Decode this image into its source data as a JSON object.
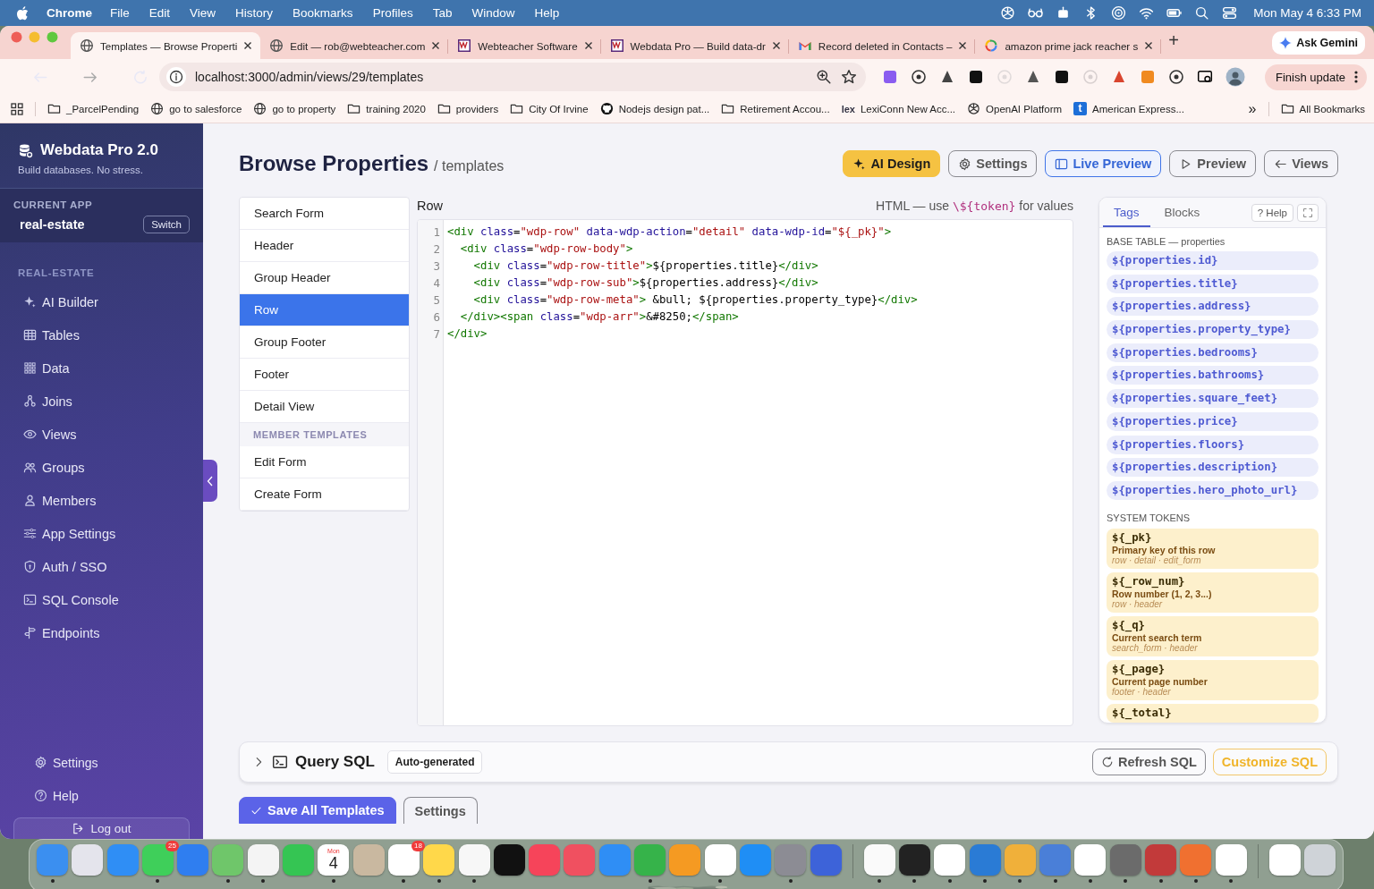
{
  "menubar": {
    "app": "Chrome",
    "menus": [
      "File",
      "Edit",
      "View",
      "History",
      "Bookmarks",
      "Profiles",
      "Tab",
      "Window",
      "Help"
    ],
    "clock": "Mon May 4  6:33 PM"
  },
  "browser_tabs": [
    {
      "title": "Templates — Browse Properti",
      "kind": "globe",
      "selected": true
    },
    {
      "title": "Edit — rob@webteacher.com",
      "kind": "globe",
      "selected": false
    },
    {
      "title": "Webteacher Software",
      "kind": "wt",
      "selected": false
    },
    {
      "title": "Webdata Pro — Build data-dr",
      "kind": "wt",
      "selected": false
    },
    {
      "title": "Record deleted in Contacts –",
      "kind": "gmail",
      "selected": false
    },
    {
      "title": "amazon prime jack reacher s",
      "kind": "google",
      "selected": false
    }
  ],
  "new_tab": "+",
  "ask_gemini": "Ask Gemini",
  "address": "localhost:3000/admin/views/29/templates",
  "finish_update": "Finish update",
  "bookmarks": [
    {
      "label": "_ParcelPending",
      "kind": "folder"
    },
    {
      "label": "go to salesforce",
      "kind": "globe"
    },
    {
      "label": "go to property",
      "kind": "globe"
    },
    {
      "label": "training 2020",
      "kind": "folder"
    },
    {
      "label": "providers",
      "kind": "folder"
    },
    {
      "label": "City Of Irvine",
      "kind": "folder"
    },
    {
      "label": "Nodejs design pat...",
      "kind": "github"
    },
    {
      "label": "Retirement Accou...",
      "kind": "folder"
    },
    {
      "label": "LexiConn New Acc...",
      "kind": "lex",
      "icon_text": "lex"
    },
    {
      "label": "OpenAI Platform",
      "kind": "knot"
    },
    {
      "label": "American Express...",
      "kind": "square",
      "icon_text": "t"
    }
  ],
  "more_bookmarks": "»",
  "all_bookmarks": "All Bookmarks",
  "sidebar": {
    "brand": "Webdata Pro 2.0",
    "tagline": "Build databases. No stress.",
    "current_app_label": "CURRENT APP",
    "current_app": "real-estate",
    "switch": "Switch",
    "section": "REAL-ESTATE",
    "nav": [
      {
        "label": "AI Builder",
        "kind": "sparkle"
      },
      {
        "label": "Tables",
        "kind": "table"
      },
      {
        "label": "Data",
        "kind": "grid"
      },
      {
        "label": "Joins",
        "kind": "nodes"
      },
      {
        "label": "Views",
        "kind": "eye"
      },
      {
        "label": "Groups",
        "kind": "people"
      },
      {
        "label": "Members",
        "kind": "person"
      },
      {
        "label": "App Settings",
        "kind": "sliders"
      },
      {
        "label": "Auth / SSO",
        "kind": "shield"
      },
      {
        "label": "SQL Console",
        "kind": "terminal"
      },
      {
        "label": "Endpoints",
        "kind": "signpost"
      }
    ],
    "footer": [
      {
        "label": "Settings",
        "kind": "gear"
      },
      {
        "label": "Help",
        "kind": "help"
      }
    ],
    "logout": "Log out"
  },
  "page": {
    "title": "Browse Properties",
    "subtitle": "/ templates",
    "actions": [
      {
        "label": "AI Design",
        "kind": "accent"
      },
      {
        "label": "Settings",
        "kind": "outline"
      },
      {
        "label": "Live Preview",
        "kind": "active"
      },
      {
        "label": "Preview",
        "kind": "outline"
      },
      {
        "label": "Views",
        "kind": "outline"
      }
    ]
  },
  "templates": [
    {
      "kind": "item",
      "label": "Search Form",
      "selected": false
    },
    {
      "kind": "item",
      "label": "Header",
      "selected": false
    },
    {
      "kind": "item",
      "label": "Group Header",
      "selected": false
    },
    {
      "kind": "item",
      "label": "Row",
      "selected": true
    },
    {
      "kind": "item",
      "label": "Group Footer",
      "selected": false
    },
    {
      "kind": "item",
      "label": "Footer",
      "selected": false
    },
    {
      "kind": "item",
      "label": "Detail View",
      "selected": false
    },
    {
      "kind": "header",
      "label": "MEMBER TEMPLATES"
    },
    {
      "kind": "item",
      "label": "Edit Form",
      "selected": false
    },
    {
      "kind": "item",
      "label": "Create Form",
      "selected": false
    }
  ],
  "editor": {
    "label": "Row",
    "hint_before": "HTML — use ",
    "hint_token": "\\${token}",
    "hint_after": " for values",
    "lines": [
      {
        "number": "1",
        "segments": [
          {
            "kind": "tag",
            "text": "<div"
          },
          {
            "kind": "attr",
            "text": " class"
          },
          {
            "kind": "plain",
            "text": "="
          },
          {
            "kind": "str",
            "text": "\"wdp-row\""
          },
          {
            "kind": "attr",
            "text": " data-wdp-action"
          },
          {
            "kind": "plain",
            "text": "="
          },
          {
            "kind": "str",
            "text": "\"detail\""
          },
          {
            "kind": "attr",
            "text": " data-wdp-id"
          },
          {
            "kind": "plain",
            "text": "="
          },
          {
            "kind": "str",
            "text": "\"${_pk}\""
          },
          {
            "kind": "tag",
            "text": ">"
          }
        ]
      },
      {
        "number": "2",
        "segments": [
          {
            "kind": "tag",
            "text": "  <div"
          },
          {
            "kind": "attr",
            "text": " class"
          },
          {
            "kind": "plain",
            "text": "="
          },
          {
            "kind": "str",
            "text": "\"wdp-row-body\""
          },
          {
            "kind": "tag",
            "text": ">"
          }
        ]
      },
      {
        "number": "3",
        "segments": [
          {
            "kind": "tag",
            "text": "    <div"
          },
          {
            "kind": "attr",
            "text": " class"
          },
          {
            "kind": "plain",
            "text": "="
          },
          {
            "kind": "str",
            "text": "\"wdp-row-title\""
          },
          {
            "kind": "tag",
            "text": ">"
          },
          {
            "kind": "plain",
            "text": "${properties.title}"
          },
          {
            "kind": "tag",
            "text": "</div>"
          }
        ]
      },
      {
        "number": "4",
        "segments": [
          {
            "kind": "tag",
            "text": "    <div"
          },
          {
            "kind": "attr",
            "text": " class"
          },
          {
            "kind": "plain",
            "text": "="
          },
          {
            "kind": "str",
            "text": "\"wdp-row-sub\""
          },
          {
            "kind": "tag",
            "text": ">"
          },
          {
            "kind": "plain",
            "text": "${properties.address}"
          },
          {
            "kind": "tag",
            "text": "</div>"
          }
        ]
      },
      {
        "number": "5",
        "segments": [
          {
            "kind": "tag",
            "text": "    <div"
          },
          {
            "kind": "attr",
            "text": " class"
          },
          {
            "kind": "plain",
            "text": "="
          },
          {
            "kind": "str",
            "text": "\"wdp-row-meta\""
          },
          {
            "kind": "tag",
            "text": ">"
          },
          {
            "kind": "plain",
            "text": " &bull; ${properties.property_type}"
          },
          {
            "kind": "tag",
            "text": "</div>"
          }
        ]
      },
      {
        "number": "6",
        "segments": [
          {
            "kind": "tag",
            "text": "  </div><span"
          },
          {
            "kind": "attr",
            "text": " class"
          },
          {
            "kind": "plain",
            "text": "="
          },
          {
            "kind": "str",
            "text": "\"wdp-arr\""
          },
          {
            "kind": "tag",
            "text": ">"
          },
          {
            "kind": "plain",
            "text": "&#8250;"
          },
          {
            "kind": "tag",
            "text": "</span>"
          }
        ]
      },
      {
        "number": "7",
        "segments": [
          {
            "kind": "tag",
            "text": "</div>"
          }
        ]
      }
    ]
  },
  "tokens_panel": {
    "tabs": [
      {
        "label": "Tags",
        "selected": true
      },
      {
        "label": "Blocks",
        "selected": false
      }
    ],
    "help": "? Help",
    "base_label": "BASE TABLE — properties",
    "fields": [
      "${properties.id}",
      "${properties.title}",
      "${properties.address}",
      "${properties.property_type}",
      "${properties.bedrooms}",
      "${properties.bathrooms}",
      "${properties.square_feet}",
      "${properties.price}",
      "${properties.floors}",
      "${properties.description}",
      "${properties.hero_photo_url}"
    ],
    "system_label": "SYSTEM TOKENS",
    "system": [
      {
        "token": "${_pk}",
        "description": "Primary key of this row",
        "contexts": "row · detail · edit_form"
      },
      {
        "token": "${_row_num}",
        "description": "Row number (1, 2, 3...)",
        "contexts": "row · header"
      },
      {
        "token": "${_q}",
        "description": "Current search term",
        "contexts": "search_form · header"
      },
      {
        "token": "${_page}",
        "description": "Current page number",
        "contexts": "footer · header"
      },
      {
        "token": "${_total}"
      }
    ]
  },
  "query_sql": {
    "expanded": false,
    "title": "Query SQL",
    "badge": "Auto-generated",
    "refresh": "Refresh SQL",
    "customize": "Customize SQL"
  },
  "footer_buttons": [
    {
      "label": "Save All Templates",
      "kind": "primary"
    },
    {
      "label": "Settings",
      "kind": "outline"
    }
  ],
  "dock": [
    {
      "kind": "app",
      "color": "#3b8ff0",
      "running": true
    },
    {
      "kind": "app",
      "color": "#e4e4ec",
      "running": false
    },
    {
      "kind": "app",
      "color": "#2f8ef5",
      "running": false
    },
    {
      "kind": "app",
      "color": "#3fcf5a",
      "running": true,
      "badge": "25"
    },
    {
      "kind": "app",
      "color": "#2f7ef0",
      "running": false
    },
    {
      "kind": "app",
      "color": "#6fc66a",
      "running": true
    },
    {
      "kind": "app",
      "color": "#f4f4f4",
      "running": true
    },
    {
      "kind": "app",
      "color": "#35c553",
      "running": false
    },
    {
      "kind": "calendar",
      "color": "#ffffff",
      "running": true,
      "month": "Mon",
      "day": "4"
    },
    {
      "kind": "app",
      "color": "#c9b8a0",
      "running": false
    },
    {
      "kind": "app",
      "color": "#ffffff",
      "running": true,
      "badge": "18"
    },
    {
      "kind": "app",
      "color": "#ffd84a",
      "running": true
    },
    {
      "kind": "app",
      "color": "#f7f7f7",
      "running": true
    },
    {
      "kind": "app",
      "color": "#111111",
      "running": false
    },
    {
      "kind": "app",
      "color": "#f6445a",
      "running": false
    },
    {
      "kind": "app",
      "color": "#f05060",
      "running": false
    },
    {
      "kind": "app",
      "color": "#2f8ef5",
      "running": false
    },
    {
      "kind": "app",
      "color": "#36b34a",
      "running": true
    },
    {
      "kind": "app",
      "color": "#f59a22",
      "running": false
    },
    {
      "kind": "app",
      "color": "#ffffff",
      "running": true
    },
    {
      "kind": "app",
      "color": "#1f8ef5",
      "running": false
    },
    {
      "kind": "app",
      "color": "#8c8c94",
      "running": true
    },
    {
      "kind": "app",
      "color": "#3d63d9",
      "running": false
    },
    {
      "kind": "separator"
    },
    {
      "kind": "app",
      "color": "#fafafa",
      "running": true
    },
    {
      "kind": "app",
      "color": "#222222",
      "running": true
    },
    {
      "kind": "app",
      "color": "#ffffff",
      "running": true
    },
    {
      "kind": "app",
      "color": "#2a7bd5",
      "running": true
    },
    {
      "kind": "app",
      "color": "#f0b03a",
      "running": true
    },
    {
      "kind": "app",
      "color": "#4a7fd8",
      "running": true
    },
    {
      "kind": "app",
      "color": "#ffffff",
      "running": true
    },
    {
      "kind": "app",
      "color": "#6b6b6b",
      "running": true
    },
    {
      "kind": "app",
      "color": "#c23a3a",
      "running": true
    },
    {
      "kind": "app",
      "color": "#f07030",
      "running": true
    },
    {
      "kind": "app",
      "color": "#ffffff",
      "running": true
    },
    {
      "kind": "separator"
    },
    {
      "kind": "app",
      "color": "#ffffff",
      "running": false
    },
    {
      "kind": "app",
      "color": "#cfd3d8",
      "running": false
    }
  ]
}
